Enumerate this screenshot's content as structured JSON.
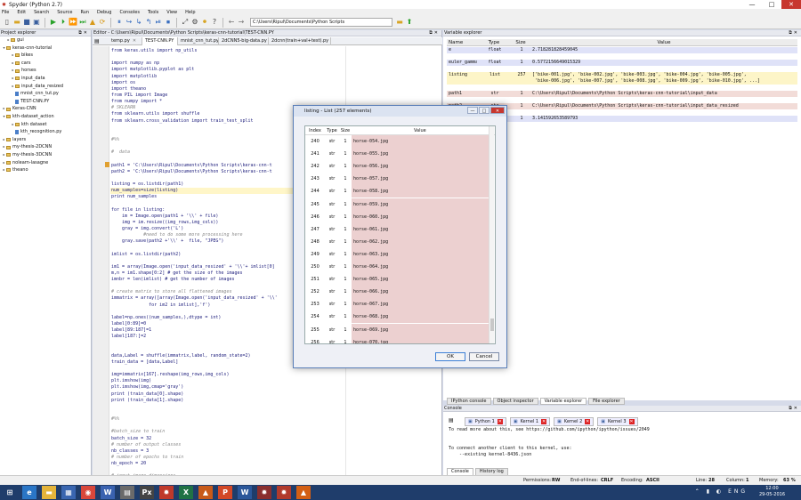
{
  "window": {
    "title": "Spyder (Python 2.7)",
    "ctrl_min": "—",
    "ctrl_max": "□",
    "ctrl_close": "✕"
  },
  "menu": [
    "File",
    "Edit",
    "Search",
    "Source",
    "Run",
    "Debug",
    "Consoles",
    "Tools",
    "View",
    "Help"
  ],
  "toolbar": {
    "path": "C:\\Users\\Ripul\\Documents\\Python Scripts",
    "back": "←",
    "fwd": "→",
    "folder": "📁",
    "up": "⬆"
  },
  "project_explorer": {
    "title": "Project explorer",
    "ctrl": "⧉✕",
    "path_hint": "C:\\Users\\Ripul\\Documents\\Python Scripts",
    "items": [
      {
        "label": "gui",
        "level": 1,
        "kind": "folder",
        "arrow": "▸"
      },
      {
        "label": "keras-cnn-tutorial",
        "level": 0,
        "kind": "folder",
        "arrow": "▾"
      },
      {
        "label": "bikes",
        "level": 2,
        "kind": "folder",
        "arrow": "▸"
      },
      {
        "label": "cars",
        "level": 2,
        "kind": "folder",
        "arrow": "▸"
      },
      {
        "label": "horses",
        "level": 2,
        "kind": "folder",
        "arrow": "▸"
      },
      {
        "label": "input_data",
        "level": 2,
        "kind": "folder",
        "arrow": "▸"
      },
      {
        "label": "input_data_resized",
        "level": 2,
        "kind": "folder",
        "arrow": "▸"
      },
      {
        "label": "mnist_cnn_tut.py",
        "level": 2,
        "kind": "file",
        "arrow": ""
      },
      {
        "label": "TEST-CNN.PY",
        "level": 2,
        "kind": "file",
        "arrow": ""
      },
      {
        "label": "Keras-CNN",
        "level": 0,
        "kind": "folder",
        "arrow": "▸"
      },
      {
        "label": "kth-dataset_action",
        "level": 0,
        "kind": "folder",
        "arrow": "▾"
      },
      {
        "label": "kth dataset",
        "level": 2,
        "kind": "folder",
        "arrow": "▸"
      },
      {
        "label": "kth_recognition.py",
        "level": 2,
        "kind": "file",
        "arrow": ""
      },
      {
        "label": "layers",
        "level": 0,
        "kind": "folder",
        "arrow": "▸"
      },
      {
        "label": "my-thesis-2DCNN",
        "level": 0,
        "kind": "folder",
        "arrow": "▸"
      },
      {
        "label": "my-thesis-3DCNN",
        "level": 0,
        "kind": "folder",
        "arrow": "▸"
      },
      {
        "label": "nolearn-lasagne",
        "level": 0,
        "kind": "folder",
        "arrow": "▸"
      },
      {
        "label": "theano",
        "level": 0,
        "kind": "folder",
        "arrow": "▸"
      }
    ]
  },
  "editor": {
    "title": "Editor - C:\\Users\\Ripul\\Documents\\Python Scripts\\keras-cnn-tutorial\\TEST-CNN.PY",
    "ctrl": "⧉✕",
    "tabs": [
      {
        "label": "temp.py",
        "close": "✕"
      },
      {
        "label": "TEST-CNN.PY",
        "close": "✕"
      },
      {
        "label": "mnist_cnn_tut.py",
        "close": "✕"
      },
      {
        "label": "2dCNN5-big-data.py",
        "close": "✕"
      },
      {
        "label": "2dcnn(train+val+test).py",
        "close": "✕"
      }
    ],
    "lines": [
      {
        "t": "from keras.utils import np_utils",
        "c": ""
      },
      {
        "t": "",
        "c": ""
      },
      {
        "t": "import numpy as np",
        "c": ""
      },
      {
        "t": "import matplotlib.pyplot as plt",
        "c": ""
      },
      {
        "t": "import matplotlib",
        "c": ""
      },
      {
        "t": "import os",
        "c": ""
      },
      {
        "t": "import theano",
        "c": ""
      },
      {
        "t": "from PIL import Image",
        "c": ""
      },
      {
        "t": "from numpy import *",
        "c": ""
      },
      {
        "t": "# SKLEARN",
        "c": "c"
      },
      {
        "t": "from sklearn.utils import shuffle",
        "c": ""
      },
      {
        "t": "from sklearn.cross_validation import train_test_split",
        "c": ""
      },
      {
        "t": "",
        "c": ""
      },
      {
        "t": "",
        "c": ""
      },
      {
        "t": "#%%",
        "c": "c"
      },
      {
        "t": "",
        "c": ""
      },
      {
        "t": "#  data",
        "c": "c"
      },
      {
        "t": "",
        "c": ""
      },
      {
        "t": "path1 = 'C:\\Users\\Ripul\\Documents\\Python Scripts\\keras-cnn-t",
        "c": ""
      },
      {
        "t": "path2 = 'C:\\Users\\Ripul\\Documents\\Python Scripts\\keras-cnn-t",
        "c": ""
      },
      {
        "t": "",
        "c": ""
      },
      {
        "t": "listing = os.listdir(path1)",
        "c": ""
      },
      {
        "t": "num_samples=size(listing)",
        "c": "cur"
      },
      {
        "t": "print num_samples",
        "c": ""
      },
      {
        "t": "",
        "c": ""
      },
      {
        "t": "for file in listing:",
        "c": ""
      },
      {
        "t": "    im = Image.open(path1 + '\\\\' + file)",
        "c": ""
      },
      {
        "t": "    img = im.resize((img_rows,img_cols))",
        "c": ""
      },
      {
        "t": "    gray = img.convert('L')",
        "c": ""
      },
      {
        "t": "            #need to do some more processing here",
        "c": "c"
      },
      {
        "t": "    gray.save(path2 +'\\\\' +  file, \"JPEG\")",
        "c": ""
      },
      {
        "t": "",
        "c": ""
      },
      {
        "t": "imlist = os.listdir(path2)",
        "c": ""
      },
      {
        "t": "",
        "c": ""
      },
      {
        "t": "im1 = array(Image.open('input_data_resized' + '\\\\'+ imlist[0]",
        "c": ""
      },
      {
        "t": "m,n = im1.shape[0:2] # get the size of the images",
        "c": ""
      },
      {
        "t": "imnbr = len(imlist) # get the number of images",
        "c": ""
      },
      {
        "t": "",
        "c": ""
      },
      {
        "t": "# create matrix to store all flattened images",
        "c": "c"
      },
      {
        "t": "immatrix = array([array(Image.open('input_data_resized' + '\\\\'",
        "c": ""
      },
      {
        "t": "              for im2 in imlist],'f')",
        "c": ""
      },
      {
        "t": "",
        "c": ""
      },
      {
        "t": "label=np.ones((num_samples,),dtype = int)",
        "c": ""
      },
      {
        "t": "label[0:89]=0",
        "c": ""
      },
      {
        "t": "label[89:187]=1",
        "c": ""
      },
      {
        "t": "label[187:]=2",
        "c": ""
      },
      {
        "t": "",
        "c": ""
      },
      {
        "t": "",
        "c": ""
      },
      {
        "t": "data,Label = shuffle(immatrix,label, random_state=2)",
        "c": ""
      },
      {
        "t": "train_data = [data,Label]",
        "c": ""
      },
      {
        "t": "",
        "c": ""
      },
      {
        "t": "img=immatrix[167].reshape(img_rows,img_cols)",
        "c": ""
      },
      {
        "t": "plt.imshow(img)",
        "c": ""
      },
      {
        "t": "plt.imshow(img,cmap='gray')",
        "c": ""
      },
      {
        "t": "print (train_data[0].shape)",
        "c": ""
      },
      {
        "t": "print (train_data[1].shape)",
        "c": ""
      },
      {
        "t": "",
        "c": ""
      },
      {
        "t": "",
        "c": ""
      },
      {
        "t": "#%%",
        "c": "c"
      },
      {
        "t": "",
        "c": ""
      },
      {
        "t": "#batch_size to train",
        "c": "c"
      },
      {
        "t": "batch_size = 32",
        "c": ""
      },
      {
        "t": "# number of output classes",
        "c": "c"
      },
      {
        "t": "nb_classes = 3",
        "c": ""
      },
      {
        "t": "# number of epochs to train",
        "c": "c"
      },
      {
        "t": "nb_epoch = 20",
        "c": ""
      },
      {
        "t": "",
        "c": ""
      },
      {
        "t": "# input image dimensions",
        "c": "c"
      },
      {
        "t": "img_rows, img_cols = 200, 200",
        "c": ""
      }
    ]
  },
  "variable_explorer": {
    "title": "Variable explorer",
    "ctrl": "⧉✕",
    "headers": {
      "name": "Name",
      "type": "Type",
      "size": "Size",
      "value": "Value"
    },
    "rows": [
      {
        "name": "e",
        "type": "float",
        "size": "1",
        "value": "2.718281828459045",
        "value2": "",
        "bg": "#dfe2f8"
      },
      {
        "name": "euler_gamma",
        "type": "float",
        "size": "1",
        "value": "0.5772156649015329",
        "value2": "",
        "bg": "#dfe2f8"
      },
      {
        "name": "listing",
        "type": "list",
        "size": "257",
        "value": "['bike-001.jpg', 'bike-002.jpg', 'bike-003.jpg', 'bike-004.jpg', 'bike-005.jpg',",
        "value2": " 'bike-006.jpg', 'bike-007.jpg', 'bike-008.jpg', 'bike-009.jpg', 'bike-010.jpg', ...]",
        "bg": "#fdf5c8"
      },
      {
        "name": "path1",
        "type": "str",
        "size": "1",
        "value": "C:\\Users\\Ripul\\Documents\\Python Scripts\\keras-cnn-tutorial\\input_data",
        "value2": "",
        "bg": "#f2dcd8"
      },
      {
        "name": "path2",
        "type": "str",
        "size": "1",
        "value": "C:\\Users\\Ripul\\Documents\\Python Scripts\\keras-cnn-tutorial\\input_data_resized",
        "value2": "",
        "bg": "#f2dcd8"
      },
      {
        "name": "pi",
        "type": "float",
        "size": "1",
        "value": "3.141592653589793",
        "value2": "",
        "bg": "#dfe2f8"
      }
    ],
    "tabs": [
      {
        "label": "IPython console",
        "sel": false
      },
      {
        "label": "Object inspector",
        "sel": false
      },
      {
        "label": "Variable explorer",
        "sel": true
      },
      {
        "label": "File explorer",
        "sel": false
      }
    ]
  },
  "console": {
    "title": "Console",
    "ctrl": "⧉✕",
    "tabs": [
      {
        "label": "Python 1",
        "close": "✕"
      },
      {
        "label": "Kernel 1",
        "close": "✕"
      },
      {
        "label": "Kernel 2",
        "close": "✕"
      },
      {
        "label": "Kernel 3",
        "close": "✕"
      }
    ],
    "text": "To read more about this, see https://github.com/ipython/ipython/issues/2049\n\n\nTo connect another client to this kernel, use:\n    --existing kernel-8436.json",
    "bottom_tabs": [
      {
        "label": "Console",
        "sel": true
      },
      {
        "label": "History log",
        "sel": false
      }
    ]
  },
  "status": {
    "permissions_label": "Permissions:",
    "permissions": "RW",
    "eol_label": "End-of-lines:",
    "eol": "CRLF",
    "encoding_label": "Encoding:",
    "encoding": "ASCII",
    "line_label": "Line:",
    "line": "28",
    "column_label": "Column:",
    "column": "1",
    "memory_label": "Memory:",
    "memory": "63 %"
  },
  "dialog": {
    "title": "listing - List (257 elements)",
    "ctrl_min": "—",
    "ctrl_max": "□",
    "ctrl_close": "✕",
    "headers": {
      "index": "Index",
      "type": "Type",
      "size": "Size",
      "value": "Value"
    },
    "rows": [
      {
        "index": "240",
        "type": "str",
        "size": "1",
        "value": "horse-054.jpg"
      },
      {
        "index": "241",
        "type": "str",
        "size": "1",
        "value": "horse-055.jpg"
      },
      {
        "index": "242",
        "type": "str",
        "size": "1",
        "value": "horse-056.jpg"
      },
      {
        "index": "243",
        "type": "str",
        "size": "1",
        "value": "horse-057.jpg"
      },
      {
        "index": "244",
        "type": "str",
        "size": "1",
        "value": "horse-058.jpg"
      },
      {
        "index": "245",
        "type": "str",
        "size": "1",
        "value": "horse-059.jpg"
      },
      {
        "index": "246",
        "type": "str",
        "size": "1",
        "value": "horse-060.jpg"
      },
      {
        "index": "247",
        "type": "str",
        "size": "1",
        "value": "horse-061.jpg"
      },
      {
        "index": "248",
        "type": "str",
        "size": "1",
        "value": "horse-062.jpg"
      },
      {
        "index": "249",
        "type": "str",
        "size": "1",
        "value": "horse-063.jpg"
      },
      {
        "index": "250",
        "type": "str",
        "size": "1",
        "value": "horse-064.jpg"
      },
      {
        "index": "251",
        "type": "str",
        "size": "1",
        "value": "horse-065.jpg"
      },
      {
        "index": "252",
        "type": "str",
        "size": "1",
        "value": "horse-066.jpg"
      },
      {
        "index": "253",
        "type": "str",
        "size": "1",
        "value": "horse-067.jpg"
      },
      {
        "index": "254",
        "type": "str",
        "size": "1",
        "value": "horse-068.jpg"
      },
      {
        "index": "255",
        "type": "str",
        "size": "1",
        "value": "horse-069.jpg"
      },
      {
        "index": "256",
        "type": "str",
        "size": "1",
        "value": "horse-070.jpg"
      }
    ],
    "ok": "OK",
    "cancel": "Cancel"
  },
  "taskbar": {
    "apps": [
      {
        "name": "start",
        "glyph": "⊞",
        "color": "#1f3d6b"
      },
      {
        "name": "ie",
        "glyph": "e",
        "color": "#2a76c6"
      },
      {
        "name": "explorer",
        "glyph": "▬",
        "color": "#e4b43a"
      },
      {
        "name": "store",
        "glyph": "▦",
        "color": "#3a66b0"
      },
      {
        "name": "chrome",
        "glyph": "◉",
        "color": "#d9473b"
      },
      {
        "name": "word-alt",
        "glyph": "W",
        "color": "#3a62b0"
      },
      {
        "name": "notes",
        "glyph": "▤",
        "color": "#6a6a6a"
      },
      {
        "name": "pix",
        "glyph": "Px",
        "color": "#444"
      },
      {
        "name": "spyder",
        "glyph": "✹",
        "color": "#c0392b"
      },
      {
        "name": "excel",
        "glyph": "X",
        "color": "#207245"
      },
      {
        "name": "matlab",
        "glyph": "▲",
        "color": "#c85a19"
      },
      {
        "name": "powerpoint",
        "glyph": "P",
        "color": "#d24726"
      },
      {
        "name": "word",
        "glyph": "W",
        "color": "#2b579a"
      },
      {
        "name": "settings",
        "glyph": "✹",
        "color": "#8a2f2f"
      },
      {
        "name": "spyder2",
        "glyph": "✹",
        "color": "#b13a2c"
      },
      {
        "name": "matlab2",
        "glyph": "▲",
        "color": "#d35f14"
      }
    ],
    "tray": "⌃ ▮ ◐ ENG",
    "time": "12:00",
    "date": "29-05-2016"
  }
}
